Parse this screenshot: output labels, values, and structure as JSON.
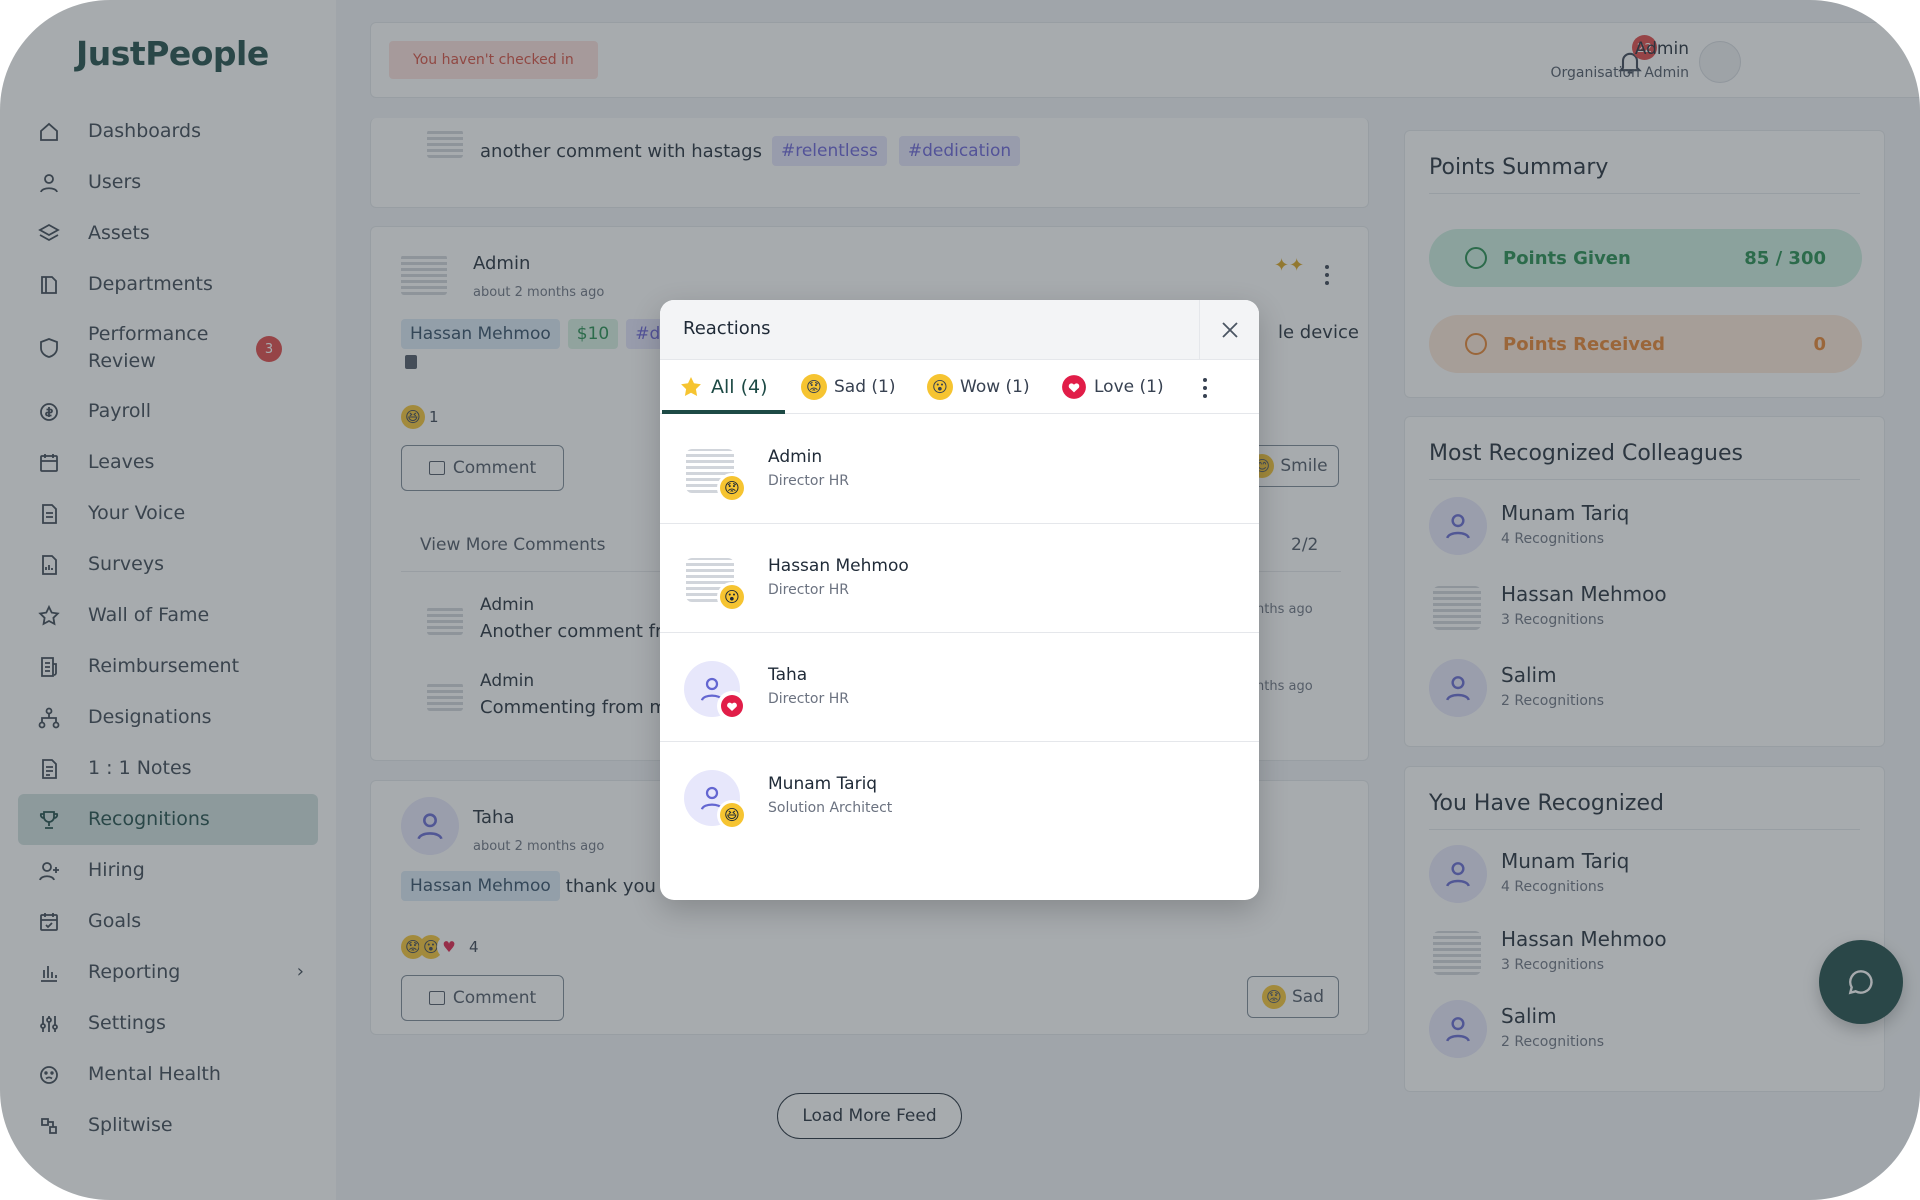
{
  "app": {
    "logo": "JustPeople"
  },
  "sidebar": {
    "items": [
      {
        "label": "Dashboards"
      },
      {
        "label": "Users"
      },
      {
        "label": "Assets"
      },
      {
        "label": "Departments"
      },
      {
        "label": "Performance Review",
        "badge": "3"
      },
      {
        "label": "Payroll"
      },
      {
        "label": "Leaves"
      },
      {
        "label": "Your Voice"
      },
      {
        "label": "Surveys"
      },
      {
        "label": "Wall of Fame"
      },
      {
        "label": "Reimbursement"
      },
      {
        "label": "Designations"
      },
      {
        "label": "1 : 1 Notes"
      },
      {
        "label": "Recognitions"
      },
      {
        "label": "Hiring"
      },
      {
        "label": "Goals"
      },
      {
        "label": "Reporting",
        "chevron": "›"
      },
      {
        "label": "Settings"
      },
      {
        "label": "Mental Health"
      },
      {
        "label": "Splitwise"
      }
    ]
  },
  "topbar": {
    "checkin": "You haven't checked in",
    "notifications": "22",
    "user_name": "Admin",
    "user_role": "Organisation Admin"
  },
  "feed": {
    "post0": {
      "comment": "another comment with hastags",
      "tags": [
        "#relentless",
        "#dedication"
      ]
    },
    "post1": {
      "author": "Admin",
      "time": "about 2 months ago",
      "recipient": "Hassan Mehmoo",
      "amount": "$10",
      "tag_partial": "#d",
      "text_tail": "le device",
      "reaction_count": "1",
      "comment_label": "Comment",
      "reaction_button": "Smile",
      "view_more": "View More Comments",
      "comment_count": "2/2",
      "comments": [
        {
          "author": "Admin",
          "text": "Another comment fro",
          "time": "nths ago"
        },
        {
          "author": "Admin",
          "text": "Commenting from m",
          "time": "nths ago"
        }
      ]
    },
    "post2": {
      "author": "Taha",
      "time": "about 2 months ago",
      "recipient": "Hassan Mehmoo",
      "text": "thank you",
      "reaction_count": "4",
      "comment_label": "Comment",
      "reaction_button": "Sad"
    },
    "load_more": "Load More Feed"
  },
  "points": {
    "title": "Points Summary",
    "given_label": "Points Given",
    "given_value": "85 / 300",
    "received_label": "Points Received",
    "received_value": "0"
  },
  "most_recognized": {
    "title": "Most Recognized Colleagues",
    "people": [
      {
        "name": "Munam Tariq",
        "count": "4 Recognitions"
      },
      {
        "name": "Hassan Mehmoo",
        "count": "3 Recognitions"
      },
      {
        "name": "Salim",
        "count": "2 Recognitions"
      }
    ]
  },
  "you_recognized": {
    "title": "You Have Recognized",
    "people": [
      {
        "name": "Munam Tariq",
        "count": "4 Recognitions"
      },
      {
        "name": "Hassan Mehmoo",
        "count": "3 Recognitions"
      },
      {
        "name": "Salim",
        "count": "2 Recognitions"
      }
    ]
  },
  "modal": {
    "title": "Reactions",
    "tabs": [
      {
        "label": "All (4)",
        "icon": "star-icon"
      },
      {
        "label": "Sad (1)",
        "icon": "sad-emoji-icon"
      },
      {
        "label": "Wow (1)",
        "icon": "wow-emoji-icon"
      },
      {
        "label": "Love (1)",
        "icon": "heart-icon"
      }
    ],
    "reactors": [
      {
        "name": "Admin",
        "role": "Director HR",
        "reaction": "sad"
      },
      {
        "name": "Hassan Mehmoo",
        "role": "Director HR",
        "reaction": "wow"
      },
      {
        "name": "Taha",
        "role": "Director HR",
        "reaction": "love"
      },
      {
        "name": "Munam Tariq",
        "role": "Solution Architect",
        "reaction": "laugh"
      }
    ]
  },
  "colors": {
    "brand": "#1d4a45",
    "danger": "#e04444",
    "tag": "#6760d8",
    "points_given": "#1f8a4c",
    "points_received": "#e8822d"
  }
}
